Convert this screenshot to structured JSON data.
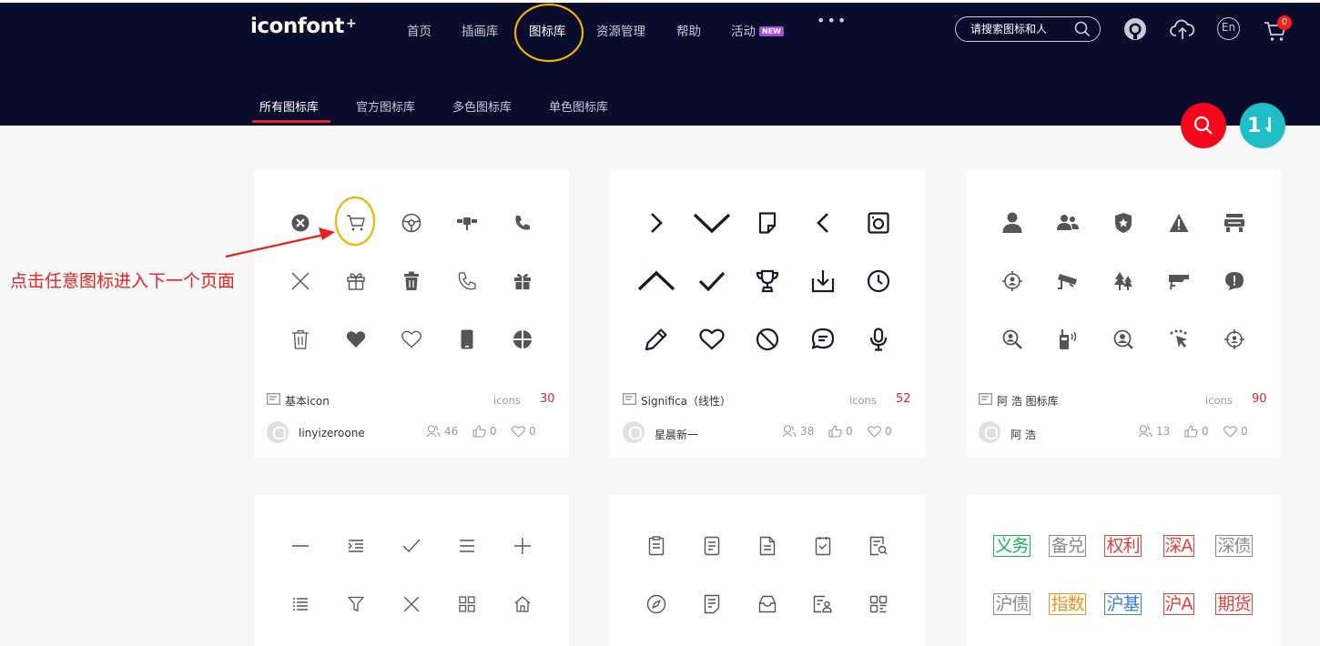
{
  "header": {
    "logo": "iconfont",
    "logo_mark": "+",
    "nav": [
      {
        "label": "首页",
        "active": false
      },
      {
        "label": "插画库",
        "active": false
      },
      {
        "label": "图标库",
        "active": true
      },
      {
        "label": "资源管理",
        "active": false
      },
      {
        "label": "帮助",
        "active": false
      },
      {
        "label": "活动",
        "active": false,
        "badge": "NEW"
      }
    ],
    "more": "•••",
    "search_placeholder": "请搜索图标和人",
    "cart_count": "0",
    "icons": [
      "github-icon",
      "upload-icon",
      "language-en-icon",
      "cart-icon"
    ],
    "language": "En"
  },
  "sub_tabs": [
    "所有图标库",
    "官方图标库",
    "多色图标库",
    "单色图标库"
  ],
  "fab": {
    "search": "search-icon",
    "sort": "1⇃"
  },
  "annotation": "点击任意图标进入下一个页面",
  "cards": [
    {
      "name": "基本icon",
      "icons_label": "icons",
      "count": "30",
      "author": "linyizeroone",
      "views": "46",
      "likes": "0",
      "favs": "0",
      "icons": [
        "close-circle-icon",
        "cart-icon",
        "steering-wheel-icon",
        "satellite-icon",
        "phone-icon",
        "close-icon",
        "gift-outline-icon",
        "trash-filled-icon",
        "phone-outline-icon",
        "gift-filled-icon",
        "trash-outline-icon",
        "heart-filled-icon",
        "heart-outline-icon",
        "mobile-icon",
        "target-circle-icon"
      ]
    },
    {
      "name": "Significa（线性）",
      "icons_label": "icons",
      "count": "52",
      "author": "星晨新一",
      "views": "38",
      "likes": "0",
      "favs": "0",
      "icons": [
        "chevron-right-icon",
        "chevron-down-icon",
        "note-icon",
        "chevron-left-icon",
        "camera-square-icon",
        "chevron-up-icon",
        "check-icon",
        "trophy-icon",
        "download-tray-icon",
        "clock-icon",
        "pencil-icon",
        "heart-outline-icon",
        "ban-icon",
        "chat-bubble-icon",
        "microphone-icon"
      ]
    },
    {
      "name": "阿 浩 图标库",
      "icons_label": "icons",
      "count": "90",
      "author": "阿 浩",
      "views": "13",
      "likes": "0",
      "favs": "0",
      "icons": [
        "person-icon",
        "group-icon",
        "police-badge-icon",
        "warning-icon",
        "turnstile-icon",
        "target-person-icon",
        "cctv-icon",
        "tree-icon",
        "camera-bullet-icon",
        "alert-shield-icon",
        "search-person-icon",
        "walkie-talkie-icon",
        "locate-person-icon",
        "route-pointer-icon",
        "crosshair-person-icon"
      ]
    },
    {
      "name": "",
      "count": "",
      "icons": [
        "minus-icon",
        "indent-list-icon",
        "check-thin-icon",
        "menu-icon",
        "plus-icon",
        "list-icon",
        "filter-icon",
        "close-thin-icon",
        "grid-icon",
        "home-icon"
      ]
    },
    {
      "name": "",
      "count": "",
      "icons": [
        "doc-clip-icon",
        "doc-lines-icon",
        "doc-corner-icon",
        "doc-check-icon",
        "doc-search-icon",
        "compass-icon",
        "doc-fold-icon",
        "tray-icon",
        "doc-person-icon",
        "qr-grid-icon"
      ]
    },
    {
      "name": "",
      "count": "",
      "words": [
        {
          "text": "义务",
          "color": "#19b25a"
        },
        {
          "text": "备兑",
          "color": "#8a8a8a"
        },
        {
          "text": "权利",
          "color": "#e0413c"
        },
        {
          "text": "深A",
          "color": "#e0413c"
        },
        {
          "text": "深债",
          "color": "#8a8a8a"
        },
        {
          "text": "沪债",
          "color": "#8a8a8a"
        },
        {
          "text": "指数",
          "color": "#f0901e"
        },
        {
          "text": "沪基",
          "color": "#3c7be0"
        },
        {
          "text": "沪A",
          "color": "#e0413c"
        },
        {
          "text": "期货",
          "color": "#e0413c"
        }
      ]
    }
  ],
  "colors": {
    "header_bg": "#0a0c2c",
    "accent": "#e0252b",
    "highlight": "#f0b400"
  }
}
